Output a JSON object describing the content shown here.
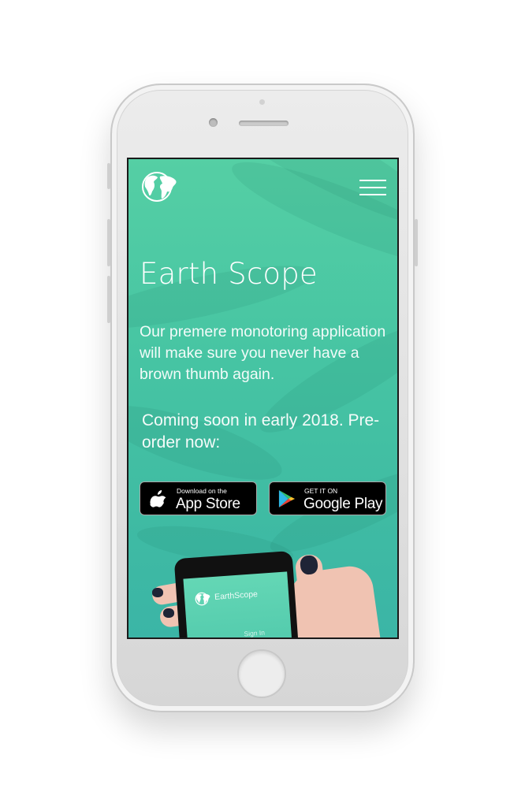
{
  "app": {
    "title": "Earth Scope",
    "tagline": "Our premere monotoring application will make sure you never have a brown thumb again.",
    "coming_soon": "Coming soon in early 2018. Pre-order now:"
  },
  "header": {
    "logo_icon": "globe-icon",
    "menu_icon": "hamburger-menu-icon"
  },
  "store_buttons": {
    "app_store": {
      "small": "Download on the",
      "big": "App Store",
      "icon": "apple-icon"
    },
    "google_play": {
      "small": "GET IT ON",
      "big": "Google Play",
      "icon": "play-triangle-icon"
    }
  },
  "mockup": {
    "app_name": "EarthScope",
    "signin_label": "Sign In"
  },
  "colors": {
    "accent_top": "#55cfa4",
    "accent_bottom": "#3bb5a6",
    "text": "#ffffff",
    "button_bg": "#000000"
  }
}
